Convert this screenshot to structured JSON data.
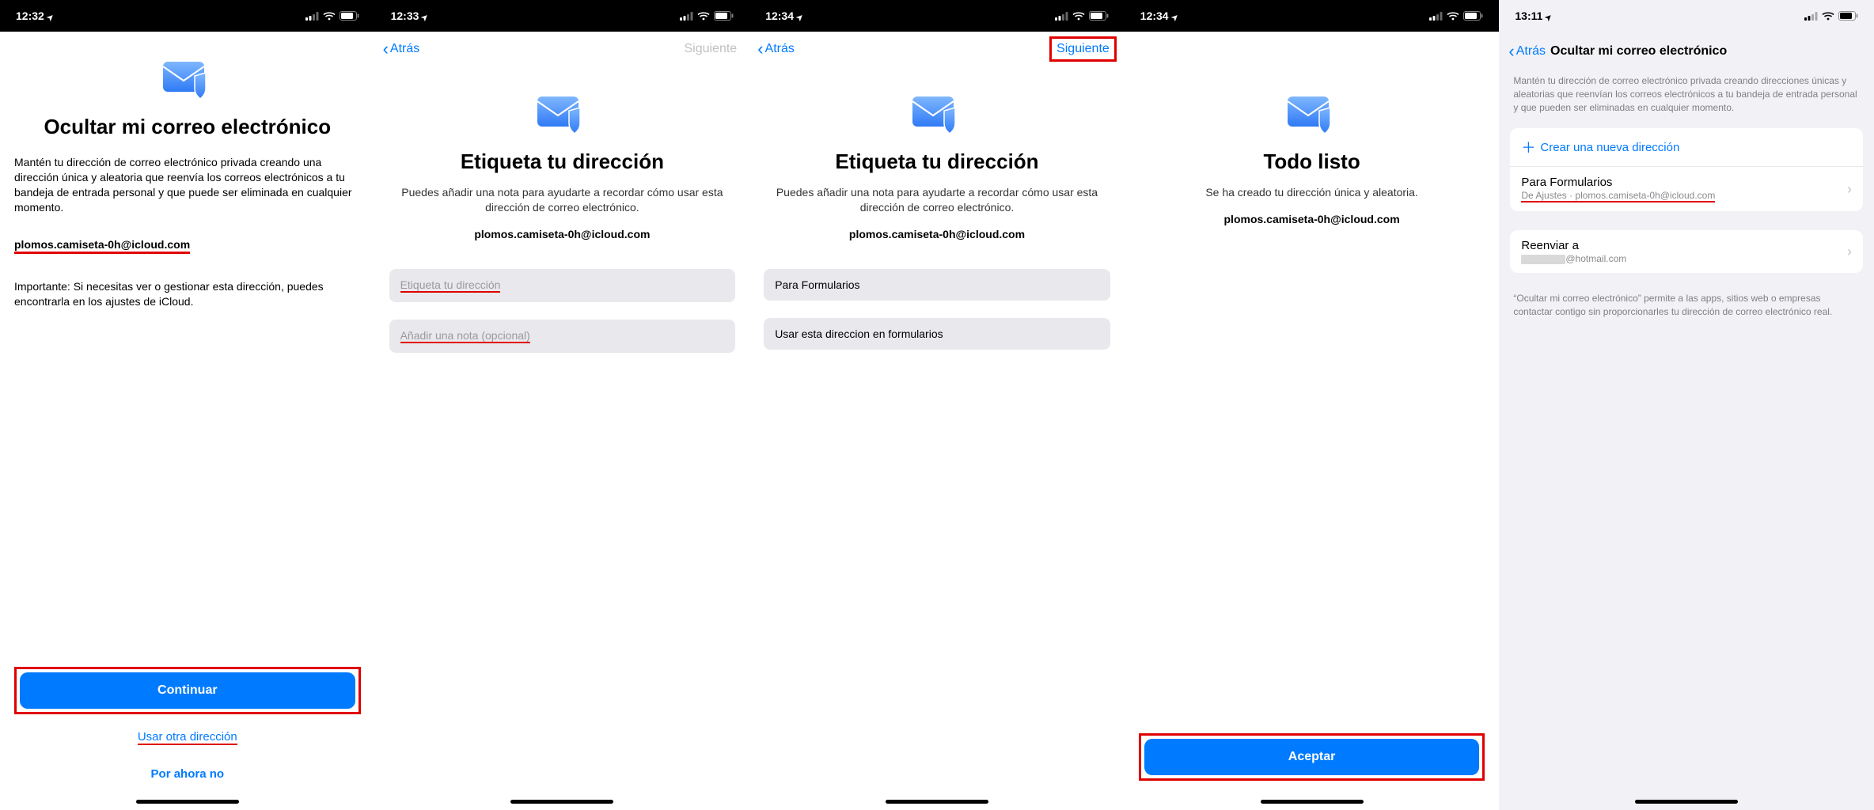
{
  "screens": [
    {
      "statusTime": "12:32",
      "title": "Ocultar mi correo electrónico",
      "desc": "Mantén tu dirección de correo electrónico privada creando una dirección única y aleatoria que reenvía los correos electrónicos a tu bandeja de entrada personal y que puede ser eliminada en cualquier momento.",
      "generatedEmail": "plomos.camiseta-0h@icloud.com",
      "note": "Importante: Si necesitas ver o gestionar esta dirección, puedes encontrarla en los ajustes de iCloud.",
      "primaryBtn": "Continuar",
      "altLink": "Usar otra dirección",
      "skipLink": "Por ahora no"
    },
    {
      "statusTime": "12:33",
      "back": "Atrás",
      "next": "Siguiente",
      "title": "Etiqueta tu dirección",
      "subtitle": "Puedes añadir una nota para ayudarte a recordar cómo usar esta dirección de correo electrónico.",
      "generatedEmail": "plomos.camiseta-0h@icloud.com",
      "labelPlaceholder": "Etiqueta tu dirección",
      "notePlaceholder": "Añadir una nota (opcional)"
    },
    {
      "statusTime": "12:34",
      "back": "Atrás",
      "next": "Siguiente",
      "title": "Etiqueta tu dirección",
      "subtitle": "Puedes añadir una nota para ayudarte a recordar cómo usar esta dirección de correo electrónico.",
      "generatedEmail": "plomos.camiseta-0h@icloud.com",
      "labelValue": "Para Formularios",
      "noteValue": "Usar esta direccion en formularios"
    },
    {
      "statusTime": "12:34",
      "title": "Todo listo",
      "subtitle": "Se ha creado tu dirección única y aleatoria.",
      "generatedEmail": "plomos.camiseta-0h@icloud.com",
      "primaryBtn": "Aceptar"
    },
    {
      "statusTime": "13:11",
      "back": "Atrás",
      "settingsTitle": "Ocultar mi correo electrónico",
      "settingsDesc": "Mantén tu dirección de correo electrónico privada creando direcciones únicas y aleatorias que reenvían los correos electrónicos a tu bandeja de entrada personal y que pueden ser eliminadas en cualquier momento.",
      "createNew": "Crear una nueva dirección",
      "alias": {
        "title": "Para Formularios",
        "sub": "De Ajustes · plomos.camiseta-0h@icloud.com"
      },
      "forward": {
        "title": "Reenviar a",
        "domain": "@hotmail.com"
      },
      "footer": "“Ocultar mi correo electrónico” permite a las apps, sitios web o empresas contactar contigo sin proporcionarles tu dirección de correo electrónico real."
    }
  ]
}
